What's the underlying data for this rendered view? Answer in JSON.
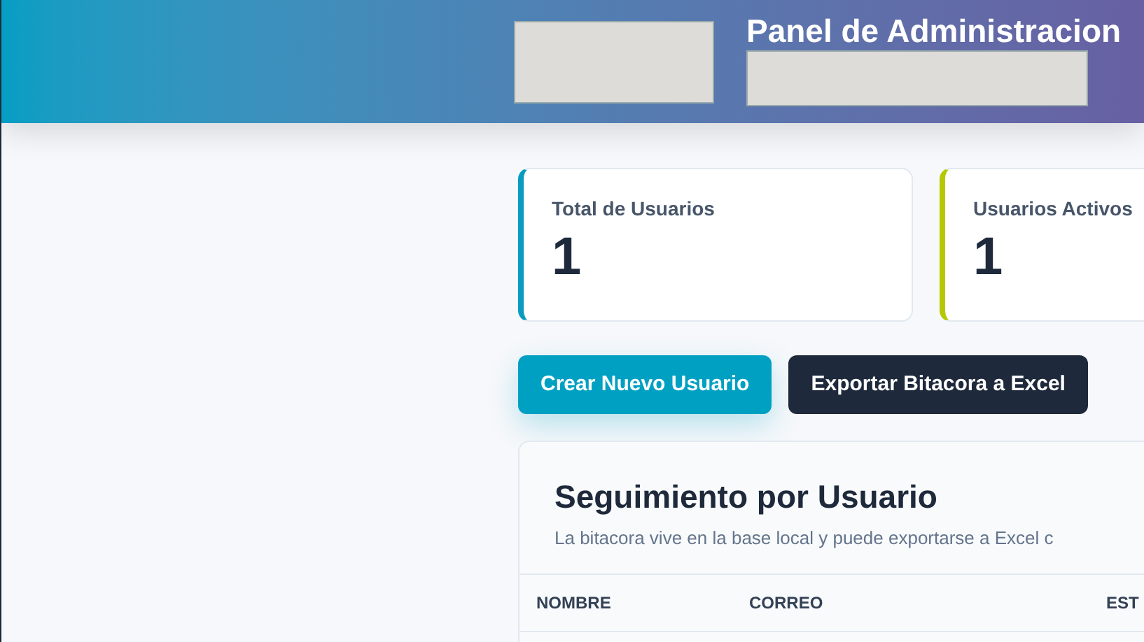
{
  "header": {
    "title": "Panel de Administracion"
  },
  "stats": [
    {
      "label": "Total de Usuarios",
      "value": "1",
      "color": "#0a9cc0"
    },
    {
      "label": "Usuarios Activos",
      "value": "1",
      "color": "#b5c800"
    }
  ],
  "actions": [
    {
      "label": "Crear Nuevo Usuario",
      "kind": "primary"
    },
    {
      "label": "Exportar Bitacora a Excel",
      "kind": "dark"
    }
  ],
  "tracking": {
    "title": "Seguimiento por Usuario",
    "description": "La bitacora vive en la base local y puede exportarse a Excel c",
    "columns": [
      "NOMBRE",
      "CORREO",
      "EST"
    ]
  }
}
